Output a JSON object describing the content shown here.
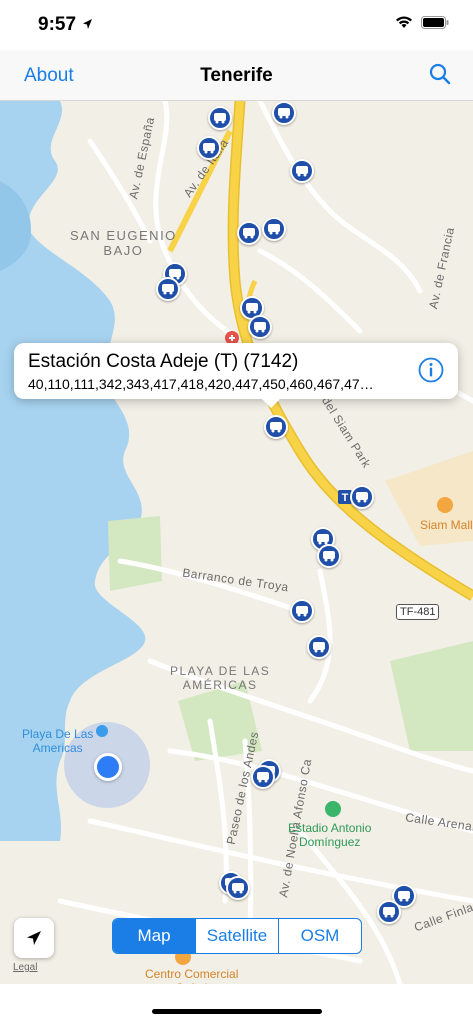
{
  "status": {
    "time": "9:57"
  },
  "navbar": {
    "about_label": "About",
    "title": "Tenerife",
    "search_icon": "search-icon"
  },
  "map": {
    "street_labels": {
      "av_espana": "Av. de España",
      "av_italia": "Av. de Italia",
      "av_francia": "Av. de Francia",
      "barranco": "Barranco de Troya",
      "paseo_andes": "Paseo de los Andes",
      "noelia": "Av. de Noelia Afonso Ca",
      "calle_arenales": "Calle Arenales",
      "calle_finlandia": "Calle Finlandia",
      "calle_siam": "Calle del Siam Park",
      "road_sign": "TF-481"
    },
    "area_labels": {
      "san_eugenio": "SAN EUGENIO\nBAJO",
      "playa_americas": "PLAYA DE LAS\nAMÉRICAS"
    },
    "poi_labels": {
      "siam_mall": "Siam Mall",
      "playa": "Playa De Las\nAmericas",
      "estadio": "Estadio Antonio\nDomínguez",
      "centro": "Centro Comercial\nSafari"
    },
    "colors": {
      "water": "#a7d3f0",
      "land": "#f2efe6",
      "highway": "#f8d347",
      "park": "#d3e8c1",
      "bus": "#1f4fa8",
      "accent": "#1a7ee6"
    }
  },
  "callout": {
    "title": "Estación Costa Adeje (T) (7142)",
    "routes": "40,110,111,342,343,417,418,420,447,450,460,467,47…",
    "info_icon": "info-icon"
  },
  "controls": {
    "locate_icon": "location-arrow-icon",
    "legal": "Legal",
    "segments": [
      "Map",
      "Satellite",
      "OSM"
    ],
    "selected": "Map"
  }
}
